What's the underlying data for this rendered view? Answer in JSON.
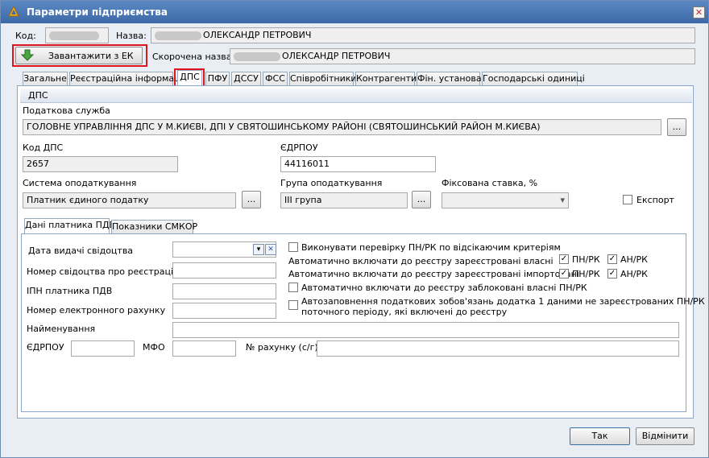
{
  "window": {
    "title": "Параметри підприємства",
    "close_glyph": "✕"
  },
  "header": {
    "code_label": "Код:",
    "name_label": "Назва:",
    "name_value": "ОЛЕКСАНДР ПЕТРОВИЧ",
    "load_button": "Завантажити з ЕК",
    "short_name_label": "Скорочена назва:",
    "short_name_value": "ОЛЕКСАНДР ПЕТРОВИЧ"
  },
  "tabs": [
    "Загальне",
    "Реєстраційна інформація",
    "ДПС",
    "ПФУ",
    "ДССУ",
    "ФСС",
    "Співробітники",
    "Контрагенти",
    "Фін. установа",
    "Господарські одиниці"
  ],
  "dps": {
    "section_title": "ДПС",
    "tax_service_label": "Податкова служба",
    "tax_service_value": "ГОЛОВНЕ УПРАВЛІННЯ ДПС У М.КИЄВІ, ДПІ У СВЯТОШИНСЬКОМУ РАЙОНІ (СВЯТОШИНСЬКИЙ РАЙОН М.КИЄВА)",
    "ellipsis": "...",
    "dps_code_label": "Код ДПС",
    "dps_code_value": "2657",
    "edrpou_label": "ЄДРПОУ",
    "edrpou_value": "44116011",
    "tax_system_label": "Система оподаткування",
    "tax_system_value": "Платник єдиного податку",
    "tax_group_label": "Група оподаткування",
    "tax_group_value": "ІІІ група",
    "fixed_rate_label": "Фіксована ставка, %",
    "export_label": "Експорт"
  },
  "subtabs": [
    "Дані платника ПДВ",
    "Показники СМКОР"
  ],
  "vat": {
    "cert_date_label": "Дата видачі свідоцтва",
    "cert_number_label": "Номер свідоцтва про реєстрацію",
    "vat_ipn_label": "ІПН платника ПДВ",
    "einvoice_label": "Номер електронного рахунку",
    "name_label": "Найменування",
    "edrpou_label": "ЄДРПОУ",
    "mfo_label": "МФО",
    "account_label": "№ рахунку (с/г)",
    "check_criteria_label": "Виконувати перевірку ПН/РК по відсікаючим критеріям",
    "auto_own_label": "Автоматично включати до реєстру зареєстровані власні",
    "auto_import_label": "Автоматично включати до реєстру зареєстровані імпортовані",
    "pn_rk": "ПН/РК",
    "an_rk": "АН/РК",
    "auto_blocked_label": "Автоматично включати до реєстру заблоковані власні ПН/РК",
    "autofill_line1": "Автозаповнення податкових зобов'язань додатка 1 даними не зареєстрованих ПН/РК",
    "autofill_line2": "поточного періоду, які включені до реєстру",
    "check_mark": "✓",
    "clear_glyph": "✕",
    "chevron": "▾"
  },
  "footer": {
    "ok": "Так",
    "cancel": "Відмінити"
  }
}
